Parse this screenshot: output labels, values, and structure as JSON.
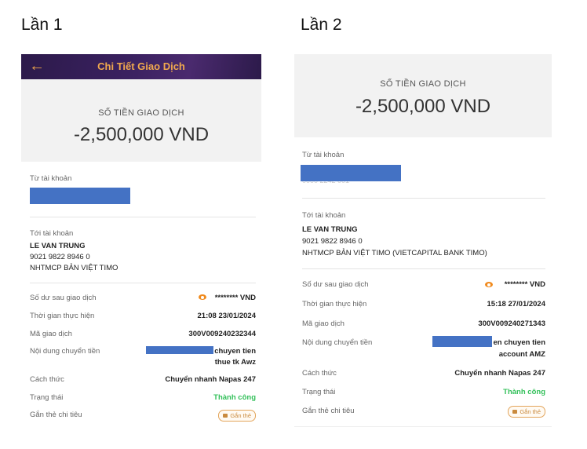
{
  "headings": {
    "left": "Lần 1",
    "right": "Lần 2"
  },
  "shot1": {
    "header_title": "Chi Tiết Giao Dịch",
    "amount_label": "SỐ TIỀN GIAO DỊCH",
    "amount_value": "-2,500,000 VND",
    "from_label": "Từ tài khoản",
    "to_label": "Tới tài khoản",
    "to_name": "LE VAN TRUNG",
    "to_number": "9021 9822 8946 0",
    "to_bank": "NHTMCP BẢN VIỆT TIMO",
    "balance_label": "Số dư sau giao dịch",
    "balance_value": "******** VND",
    "time_label": "Thời gian thực hiện",
    "time_value": "21:08 23/01/2024",
    "code_label": "Mã giao dịch",
    "code_value": "300V009240232344",
    "content_label": "Nội dung chuyển tiền",
    "content_line1": "chuyen tien",
    "content_line2": "thue tk Awz",
    "method_label": "Cách thức",
    "method_value": "Chuyển nhanh Napas 247",
    "status_label": "Trạng thái",
    "status_value": "Thành công",
    "tag_label": "Gắn thẻ chi tiêu",
    "tag_button": "Gắn thẻ"
  },
  "shot2": {
    "amount_label": "SỐ TIỀN GIAO DỊCH",
    "amount_value": "-2,500,000 VND",
    "from_label": "Từ tài khoản",
    "from_partial": "0000 2242 001",
    "to_label": "Tới tài khoản",
    "to_name": "LE VAN TRUNG",
    "to_number": "9021 9822 8946 0",
    "to_bank": "NHTMCP BẢN VIỆT TIMO (VIETCAPITAL BANK TIMO)",
    "balance_label": "Số dư sau giao dịch",
    "balance_value": "******** VND",
    "time_label": "Thời gian thực hiện",
    "time_value": "15:18 27/01/2024",
    "code_label": "Mã giao dịch",
    "code_value": "300V009240271343",
    "content_label": "Nội dung chuyển tiền",
    "content_line1": "en chuyen tien",
    "content_line2": "account AMZ",
    "method_label": "Cách thức",
    "method_value": "Chuyển nhanh Napas 247",
    "status_label": "Trạng thái",
    "status_value": "Thành công",
    "tag_label": "Gắn thẻ chi tiêu",
    "tag_button": "Gắn thẻ"
  },
  "colors": {
    "accent": "#f0a84e",
    "header_bg": "#3a2160",
    "success": "#33c05a",
    "redaction": "#4472c4"
  }
}
